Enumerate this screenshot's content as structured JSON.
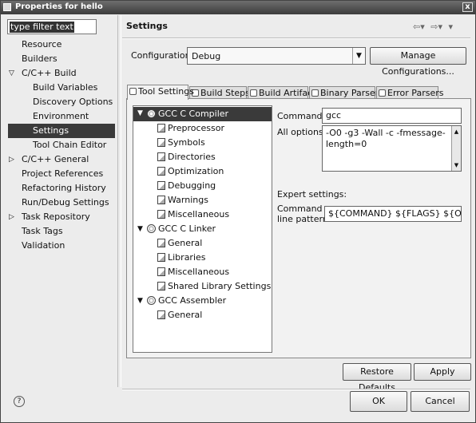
{
  "window": {
    "title": "Properties for hello",
    "close_glyph": "x"
  },
  "filter": {
    "placeholder": "",
    "value": "type filter text"
  },
  "nav": {
    "items": [
      {
        "label": "Resource"
      },
      {
        "label": "Builders"
      },
      {
        "label": "C/C++ Build",
        "twisty": "▽"
      },
      {
        "label": "Build Variables"
      },
      {
        "label": "Discovery Options"
      },
      {
        "label": "Environment"
      },
      {
        "label": "Settings"
      },
      {
        "label": "Tool Chain Editor"
      },
      {
        "label": "C/C++ General",
        "twisty": "▷"
      },
      {
        "label": "Project References"
      },
      {
        "label": "Refactoring History"
      },
      {
        "label": "Run/Debug Settings"
      },
      {
        "label": "Task Repository",
        "twisty": "▷"
      },
      {
        "label": "Task Tags"
      },
      {
        "label": "Validation"
      }
    ]
  },
  "page": {
    "title": "Settings",
    "back_glyph": "⇦▾",
    "forward_glyph": "⇨▾",
    "menu_glyph": "▾"
  },
  "configuration": {
    "label": "Configuration:",
    "value": "Debug",
    "manage_label": "Manage Configurations..."
  },
  "tabs": [
    {
      "label": "Tool Settings"
    },
    {
      "label": "Build Steps"
    },
    {
      "label": "Build Artifact"
    },
    {
      "label": "Binary Parsers"
    },
    {
      "label": "Error Parsers"
    }
  ],
  "tool_tree": {
    "items": [
      {
        "label": "GCC C Compiler",
        "twisty": "▼"
      },
      {
        "label": "Preprocessor"
      },
      {
        "label": "Symbols"
      },
      {
        "label": "Directories"
      },
      {
        "label": "Optimization"
      },
      {
        "label": "Debugging"
      },
      {
        "label": "Warnings"
      },
      {
        "label": "Miscellaneous"
      },
      {
        "label": "GCC C Linker",
        "twisty": "▼"
      },
      {
        "label": "General"
      },
      {
        "label": "Libraries"
      },
      {
        "label": "Miscellaneous"
      },
      {
        "label": "Shared Library Settings"
      },
      {
        "label": "GCC Assembler",
        "twisty": "▼"
      },
      {
        "label": "General"
      }
    ]
  },
  "settings_form": {
    "command_label": "Command:",
    "command_value": "gcc",
    "all_options_label": "All options:",
    "all_options_value": "-O0 -g3 -Wall -c -fmessage-length=0",
    "expert_label": "Expert settings:",
    "pattern_label_1": "Command",
    "pattern_label_2": "line pattern:",
    "pattern_value": "${COMMAND} ${FLAGS} ${OUTPUT"
  },
  "buttons": {
    "restore": "Restore Defaults",
    "apply": "Apply",
    "ok": "OK",
    "cancel": "Cancel",
    "help_glyph": "?"
  }
}
